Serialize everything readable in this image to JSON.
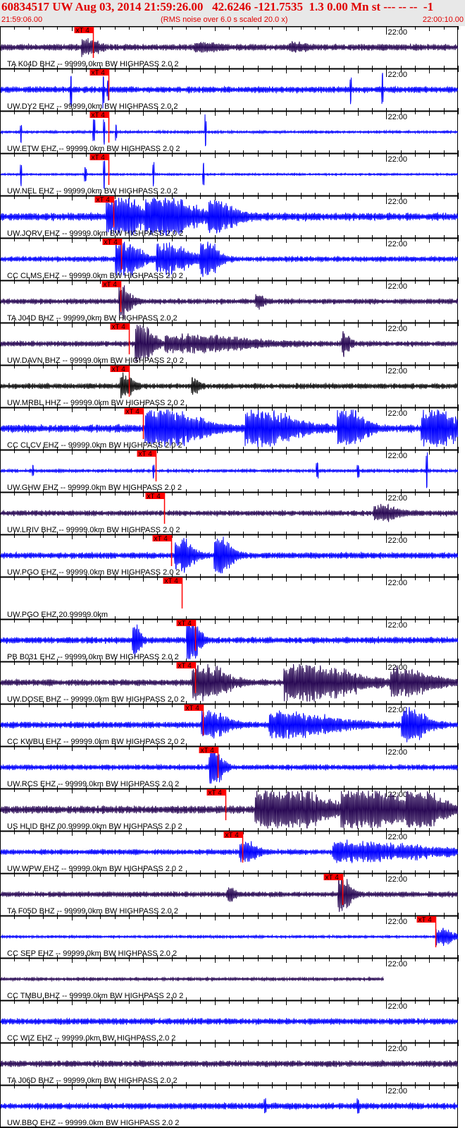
{
  "header": {
    "title": "60834517 UW Aug 03, 2014 21:59:26.00   42.6246 -121.7535  1.3 0.00 Mn st --- -- --  -1",
    "start_time": "21:59:06.00",
    "note": "(RMS noise over 6.0 s scaled 20.0 x)",
    "end_time": "22:00:10.00"
  },
  "chart_data": {
    "type": "seismogram",
    "time_range_s": [
      0,
      64
    ],
    "time_origin": "21:59:06.00",
    "minute_mark_label": "22:00",
    "minute_mark_s": 54,
    "pick_label": "xT 4",
    "colors": {
      "blue": "#0000ff",
      "purple": "#2a0a55",
      "black": "#101010",
      "pick": "#ff0000"
    },
    "traces": [
      {
        "label": "TA K04D BHZ -- 99999.0km BW  HIGHPASS  2.0  2",
        "color": "purple",
        "noise": 0.12,
        "pick": 13.0,
        "bursts": [
          [
            12,
            0.35,
            2
          ],
          [
            28,
            0.15,
            3
          ],
          [
            41,
            0.15,
            2
          ]
        ],
        "spikes": []
      },
      {
        "label": "UW.DY2 EHZ -- 99999.0km BW  HIGHPASS  2.0  2",
        "color": "blue",
        "noise": 0.12,
        "pick": 15.2,
        "bursts": [],
        "spikes": [
          [
            9.9,
            0.9
          ],
          [
            14.4,
            1
          ],
          [
            15.0,
            0.5
          ],
          [
            49,
            0.7
          ],
          [
            53.4,
            1
          ]
        ]
      },
      {
        "label": "UW.ETW EHZ -- 99999.0km BW  HIGHPASS  2.0  2",
        "color": "blue",
        "noise": 0.05,
        "pick": 15.2,
        "bursts": [],
        "spikes": [
          [
            2.9,
            0.5
          ],
          [
            13.1,
            0.6
          ],
          [
            14.5,
            0.8
          ],
          [
            16.2,
            0.4
          ],
          [
            28.7,
            0.9
          ]
        ]
      },
      {
        "label": "UW.NEL EHZ -- 99999.0km BW  HIGHPASS  2.0  2",
        "color": "blue",
        "noise": 0.04,
        "pick": 15.2,
        "bursts": [],
        "spikes": [
          [
            2.9,
            0.6
          ],
          [
            11.9,
            0.4
          ],
          [
            14.5,
            0.9
          ],
          [
            21.4,
            0.6
          ],
          [
            28.4,
            0.6
          ]
        ]
      },
      {
        "label": "UW.JORV EHZ -- 99999.0km BW  HIGHPASS  2.0  2",
        "color": "blue",
        "noise": 0.15,
        "pick": 15.9,
        "bursts": [
          [
            16,
            1,
            4
          ],
          [
            22,
            0.9,
            6
          ],
          [
            30,
            0.6,
            3
          ]
        ],
        "spikes": []
      },
      {
        "label": "CC CLMS EHZ -- 99999.0km BW  HIGHPASS  2.0  2",
        "color": "blue",
        "noise": 0.1,
        "pick": 16.9,
        "bursts": [
          [
            17,
            0.8,
            3
          ],
          [
            23,
            0.6,
            4
          ],
          [
            28.5,
            1,
            2
          ]
        ],
        "spikes": []
      },
      {
        "label": "TA J04D BHZ -- 99999.0km BW  HIGHPASS  2.0  2",
        "color": "purple",
        "noise": 0.1,
        "pick": 16.8,
        "bursts": [
          [
            17,
            0.7,
            1.5
          ],
          [
            36,
            0.3,
            1
          ]
        ],
        "spikes": []
      },
      {
        "label": "UW.DAVN BHZ -- 99999.0km BW  HIGHPASS  2.0  2",
        "color": "purple",
        "noise": 0.1,
        "pick": 18.0,
        "bursts": [
          [
            19.5,
            1,
            2
          ],
          [
            26,
            0.35,
            10
          ],
          [
            48,
            0.5,
            1
          ]
        ],
        "spikes": []
      },
      {
        "label": "UW.MRBL HHZ -- 99999.0km BW  HIGHPASS  2.0  2",
        "color": "black",
        "noise": 0.1,
        "pick": 18.0,
        "bursts": [
          [
            17.2,
            0.6,
            1.5
          ],
          [
            27,
            0.3,
            1
          ]
        ],
        "spikes": []
      },
      {
        "label": "CC CLCV EHZ -- 99999.0km BW  HIGHPASS  2.0  2",
        "color": "blue",
        "noise": 0.15,
        "pick": 20.0,
        "bursts": [
          [
            22,
            1,
            6
          ],
          [
            36,
            0.8,
            6
          ],
          [
            48,
            1,
            3
          ],
          [
            60,
            1,
            4
          ]
        ],
        "spikes": []
      },
      {
        "label": "UW.GHW EHZ -- 99999.0km BW  HIGHPASS  2.0  2",
        "color": "blue",
        "noise": 0.06,
        "pick": 21.8,
        "bursts": [],
        "spikes": [
          [
            4.6,
            0.3
          ],
          [
            21.4,
            0.4
          ],
          [
            44.3,
            0.4
          ],
          [
            50,
            0.3
          ],
          [
            59.6,
            1
          ]
        ]
      },
      {
        "label": "UW.LRIV BHZ -- 99999.0km BW  HIGHPASS  2.0  2",
        "color": "purple",
        "noise": 0.1,
        "pick": 22.9,
        "bursts": [
          [
            53,
            0.3,
            3
          ]
        ],
        "spikes": []
      },
      {
        "label": "UW.PGO EHZ -- 99999.0km BW  HIGHPASS  2.0  2",
        "color": "blue",
        "noise": 0.12,
        "pick": 23.9,
        "bursts": [
          [
            25,
            0.8,
            2
          ],
          [
            30.5,
            0.9,
            2
          ]
        ],
        "spikes": []
      },
      {
        "label": "UW.PGO EHZ 20.99999.0km",
        "color": "blue",
        "noise": 0,
        "pick": 25.4,
        "bursts": [],
        "spikes": [],
        "nodata": true
      },
      {
        "label": "PB B031 EHZ -- 99999.0km BW  HIGHPASS  2.0  2",
        "color": "blue",
        "noise": 0.12,
        "pick": 27.3,
        "bursts": [
          [
            18.8,
            0.6,
            1
          ],
          [
            26.5,
            1,
            1.5
          ]
        ],
        "spikes": []
      },
      {
        "label": "UW.DOSE BHZ -- 99999.0km BW  HIGHPASS  2.0  2",
        "color": "purple",
        "noise": 0.12,
        "pick": 27.3,
        "bursts": [
          [
            28,
            0.8,
            4
          ],
          [
            42,
            0.9,
            8
          ],
          [
            56,
            0.6,
            5
          ]
        ],
        "spikes": []
      },
      {
        "label": "CC KWBU EHZ -- 99999.0km BW  HIGHPASS  2.0  2",
        "color": "blue",
        "noise": 0.12,
        "pick": 28.4,
        "bursts": [
          [
            29,
            0.6,
            3
          ],
          [
            40,
            0.5,
            8
          ],
          [
            57,
            0.7,
            3
          ]
        ],
        "spikes": []
      },
      {
        "label": "UW.RCS EHZ -- 99999.0km BW  HIGHPASS  2.0  2",
        "color": "blue",
        "noise": 0.1,
        "pick": 30.4,
        "bursts": [
          [
            29.6,
            1,
            1.5
          ]
        ],
        "spikes": []
      },
      {
        "label": "US HLID BHZ 00.99999.0km BW  HIGHPASS  2.0  2",
        "color": "purple",
        "noise": 0.15,
        "pick": 31.5,
        "bursts": [
          [
            38,
            1,
            8
          ],
          [
            50,
            1,
            8
          ],
          [
            58,
            0.7,
            4
          ]
        ],
        "spikes": []
      },
      {
        "label": "UW.WPW EHZ -- 99999.0km BW  HIGHPASS  2.0  2",
        "color": "blue",
        "noise": 0.1,
        "pick": 33.9,
        "bursts": [
          [
            34,
            0.5,
            2
          ],
          [
            50,
            0.4,
            12
          ]
        ],
        "spikes": []
      },
      {
        "label": "TA F05D BHZ -- 99999.0km BW  HIGHPASS  2.0  2",
        "color": "purple",
        "noise": 0.1,
        "pick": 47.9,
        "bursts": [
          [
            47.7,
            0.8,
            1.5
          ],
          [
            32,
            0.25,
            1
          ]
        ],
        "spikes": []
      },
      {
        "label": "CC SEP EHZ -- 99999.0km BW  HIGHPASS  2.0  2",
        "color": "blue",
        "noise": 0.05,
        "pick": 60.8,
        "bursts": [
          [
            61.5,
            0.4,
            2
          ]
        ],
        "spikes": []
      },
      {
        "label": "CC TMBU BHZ -- 99999.0km BW  HIGHPASS  2.0  2",
        "color": "purple",
        "noise": 0.06,
        "pick": null,
        "end": 53.6,
        "bursts": [],
        "spikes": []
      },
      {
        "label": "CC WIZ EHZ -- 99999.0km BW  HIGHPASS  2.0  2",
        "color": "blue",
        "noise": 0.12,
        "pick": null,
        "bursts": [],
        "spikes": []
      },
      {
        "label": "TA J06D BHZ -- 99999.0km BW  HIGHPASS  2.0  2",
        "color": "purple",
        "noise": 0.12,
        "pick": null,
        "bursts": [],
        "spikes": []
      },
      {
        "label": "UW.BBQ EHZ -- 99999.0km BW  HIGHPASS  2.0  2",
        "color": "blue",
        "noise": 0.12,
        "pick": null,
        "bursts": [],
        "spikes": [
          [
            37,
            0.3
          ],
          [
            50,
            0.3
          ]
        ]
      }
    ]
  }
}
